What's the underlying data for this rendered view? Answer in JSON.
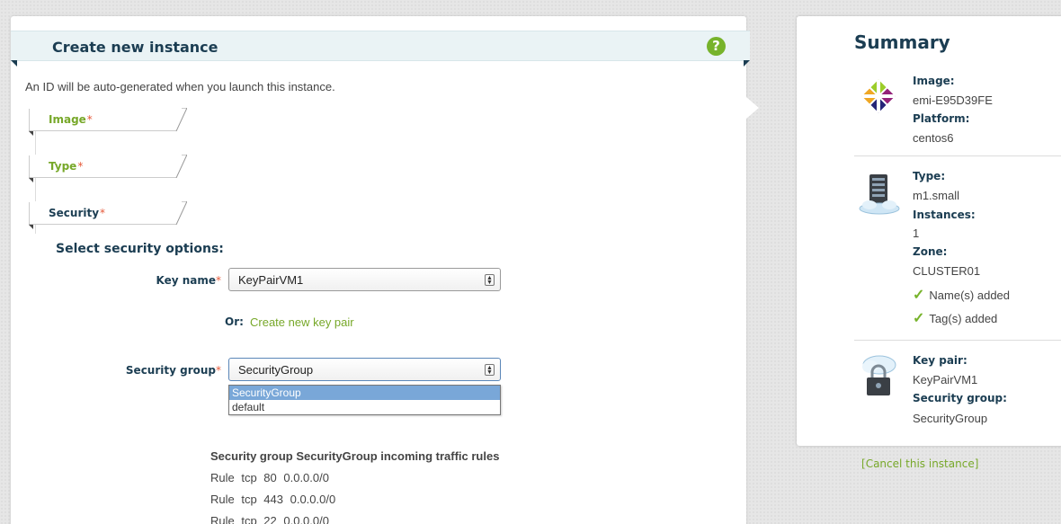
{
  "wizard": {
    "title": "Create new instance",
    "help_icon": "?",
    "intro": "An ID will be auto-generated when you launch this instance.",
    "steps": [
      {
        "label": "Image",
        "required": "*"
      },
      {
        "label": "Type",
        "required": "*"
      },
      {
        "label": "Security",
        "required": "*"
      }
    ]
  },
  "security": {
    "section_title": "Select security options:",
    "key_name_label": "Key name",
    "key_name_required": "*",
    "key_name_value": "KeyPairVM1",
    "or_label": "Or:",
    "create_key_link": "Create new key pair",
    "group_label": "Security group",
    "group_required": "*",
    "group_value": "SecurityGroup",
    "group_options": [
      "SecurityGroup",
      "default"
    ],
    "rules_title": "Security group SecurityGroup incoming traffic rules",
    "rules": [
      "Rule  tcp  80  0.0.0.0/0",
      "Rule  tcp  443  0.0.0.0/0",
      "Rule  tcp  22  0.0.0.0/0"
    ]
  },
  "summary": {
    "title": "Summary",
    "image_label": "Image:",
    "image_value": "emi-E95D39FE",
    "platform_label": "Platform:",
    "platform_value": "centos6",
    "type_label": "Type:",
    "type_value": "m1.small",
    "instances_label": "Instances:",
    "instances_value": "1",
    "zone_label": "Zone:",
    "zone_value": "CLUSTER01",
    "names_added": "Name(s) added",
    "tags_added": "Tag(s) added",
    "keypair_label": "Key pair:",
    "keypair_value": "KeyPairVM1",
    "secgroup_label": "Security group:",
    "secgroup_value": "SecurityGroup",
    "icons": [
      "centos-logo-icon",
      "server-cloud-icon",
      "cloud-lock-icon",
      "checkmark-icon"
    ]
  },
  "cancel": {
    "open": "[",
    "label": "Cancel this instance",
    "close": "]"
  },
  "colors": {
    "accent_green": "#77a829",
    "heading_navy": "#1b3d52",
    "required_red": "#e65a3a",
    "option_highlight": "#79a7d8"
  }
}
